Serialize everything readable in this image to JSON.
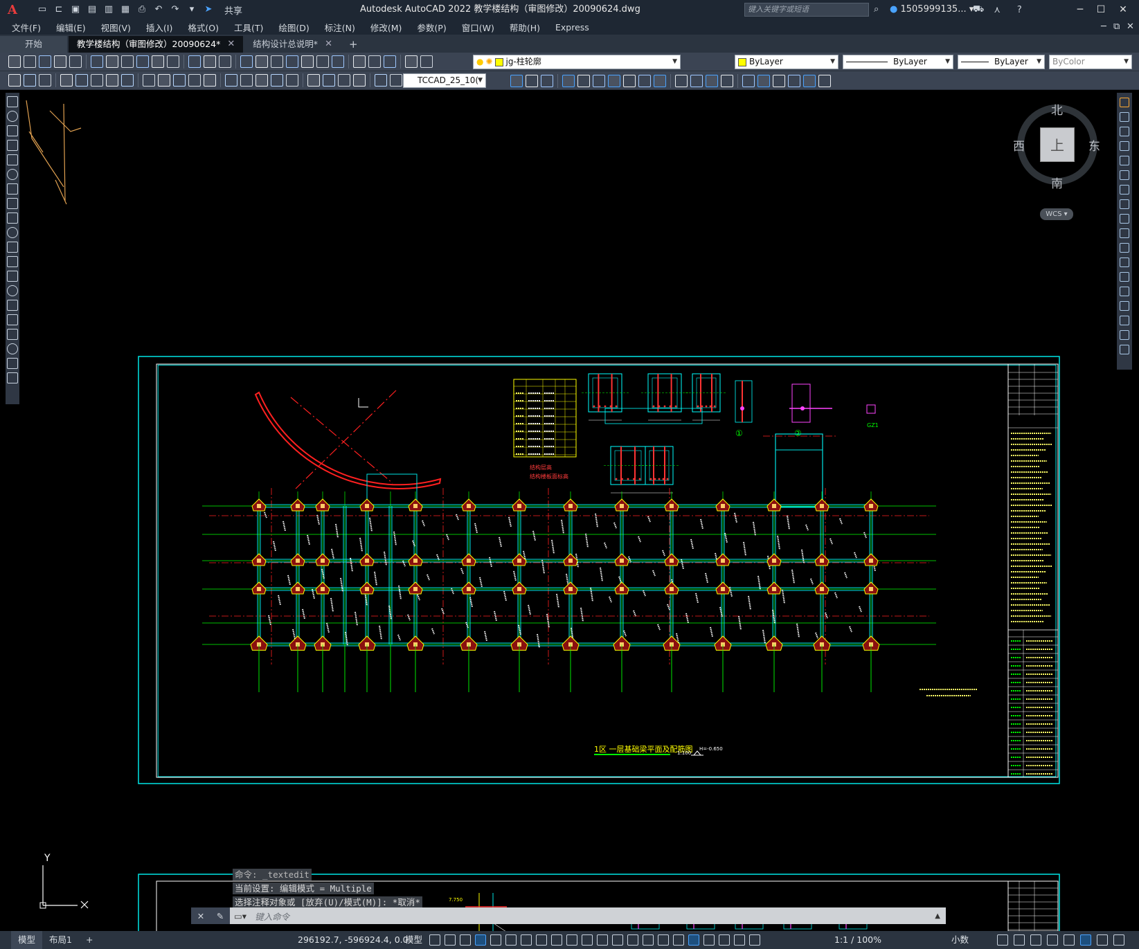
{
  "titlebar": {
    "app_title": "Autodesk AutoCAD 2022    教学楼结构（审图修改）20090624.dwg",
    "share_label": "共享",
    "search_placeholder": "键入关键字或短语",
    "user_name": "1505999135..."
  },
  "menu": {
    "items": [
      "文件(F)",
      "编辑(E)",
      "视图(V)",
      "插入(I)",
      "格式(O)",
      "工具(T)",
      "绘图(D)",
      "标注(N)",
      "修改(M)",
      "参数(P)",
      "窗口(W)",
      "帮助(H)",
      "Express"
    ]
  },
  "tabs": {
    "start": "开始",
    "items": [
      "教学楼结构（审图修改）20090624*",
      "结构设计总说明*"
    ]
  },
  "toolbar": {
    "layer_name": "jg-柱轮廓",
    "color_value": "ByLayer",
    "linetype_value": "ByLayer",
    "lineweight_value": "ByLayer",
    "plotstyle_value": "ByColor",
    "text_style": "TCCAD_25_10("
  },
  "viewcube": {
    "north": "北",
    "south": "南",
    "east": "东",
    "west": "西",
    "face": "上",
    "wcs": "WCS"
  },
  "ucs": {
    "y_label": "Y"
  },
  "drawing": {
    "plan_title": "1区  一层基础梁平面及配筋图",
    "plan_scale": "1:100",
    "detail_1": "①",
    "detail_2": "②",
    "gz_label": "GZ1",
    "elevation_note": "H=-0.650",
    "level_table_caption": "结构层高",
    "level_table_sub": "结构楼板面标高",
    "lower_elevation": "7.750"
  },
  "command": {
    "history": [
      "命令: _textedit",
      "当前设置: 编辑模式 = Multiple",
      "选择注释对象或 [放弃(U)/模式(M)]: *取消*"
    ],
    "prompt": "键入命令"
  },
  "status": {
    "tab_model": "模型",
    "tab_layout": "布局1",
    "coordinates": "296192.7, -596924.4, 0.0",
    "mode": "模型",
    "annotation_scale": "1:1 / 100%",
    "units": "小数"
  }
}
